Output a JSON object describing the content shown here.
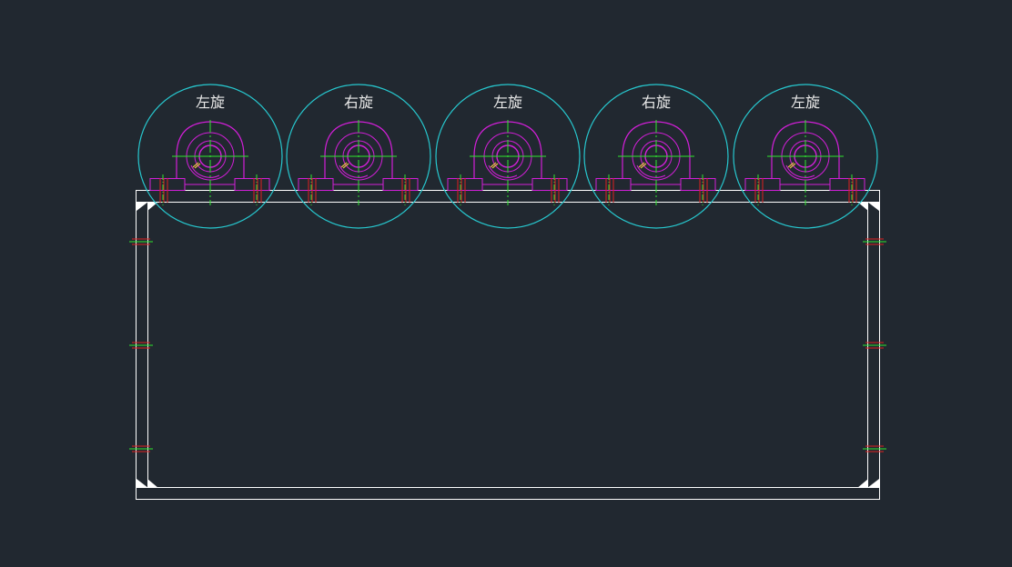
{
  "drawing": {
    "background_color": "#212830",
    "frame_color": "#ffffff",
    "roller_outline_color": "#27c8cf",
    "bearing_color": "#d21fd8",
    "centerline_color": "#2ee62e",
    "bolt_color": "#e02020",
    "label_color": "#e8e8e8"
  },
  "rollers": [
    {
      "label": "左旋",
      "rotation": "left"
    },
    {
      "label": "右旋",
      "rotation": "right"
    },
    {
      "label": "左旋",
      "rotation": "left"
    },
    {
      "label": "右旋",
      "rotation": "right"
    },
    {
      "label": "左旋",
      "rotation": "left"
    }
  ],
  "side_brackets": {
    "per_side": 3
  }
}
